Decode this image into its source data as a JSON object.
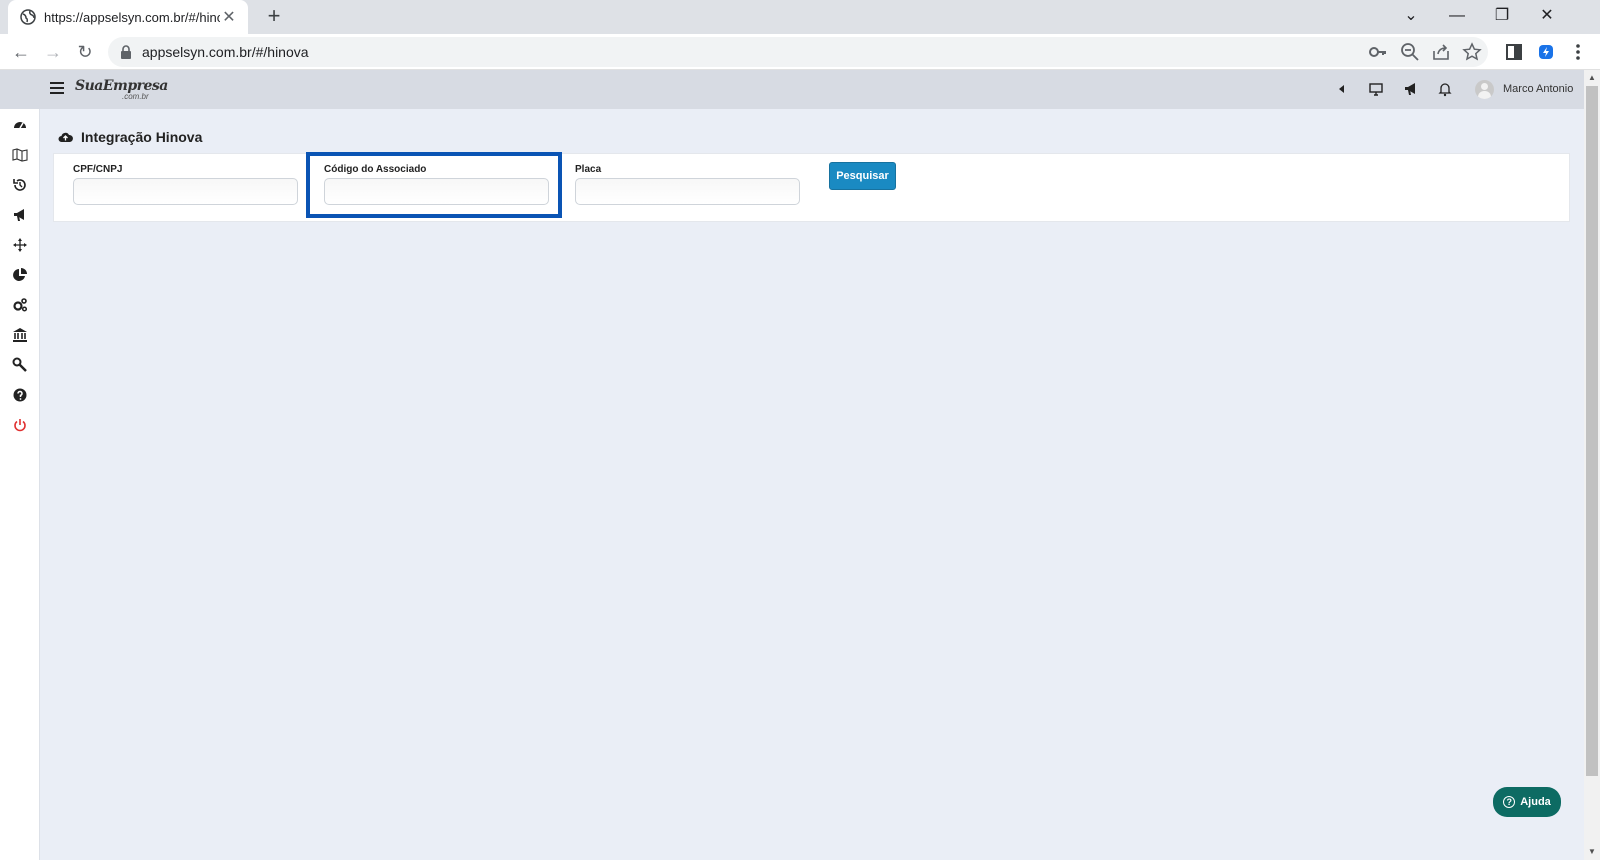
{
  "browser": {
    "tab_title": "https://appselsyn.com.br/#/hinova",
    "new_tab": "+",
    "tab_close": "✕",
    "address": "appselsyn.com.br/#/hinova",
    "window_controls": {
      "dropdown": "⌄",
      "minimize": "—",
      "restore": "❐",
      "close": "✕"
    },
    "nav": {
      "back": "←",
      "forward": "→",
      "reload": "↻"
    },
    "toolbar_icons": [
      "key-icon",
      "zoom-out-icon",
      "share-icon",
      "star-icon",
      "side-panel-icon",
      "extension-icon",
      "menu-icon"
    ]
  },
  "header": {
    "logo": "SuaEmpresa",
    "logo_sub": ".com.br",
    "user_name": "Marco Antonio",
    "icons": [
      "collapse-icon",
      "monitor-icon",
      "megaphone-icon",
      "bell-icon"
    ]
  },
  "sidebar": {
    "icons": [
      "dashboard-icon",
      "map-icon",
      "history-icon",
      "megaphone-icon",
      "move-icon",
      "pie-chart-icon",
      "cogs-icon",
      "bank-icon",
      "wrench-icon",
      "help-icon",
      "power-icon"
    ]
  },
  "page": {
    "title": "Integração Hinova"
  },
  "form": {
    "cpf_label": "CPF/CNPJ",
    "cpf_value": "",
    "codigo_label": "Código do Associado",
    "codigo_value": "",
    "placa_label": "Placa",
    "placa_value": "",
    "search_button": "Pesquisar"
  },
  "help": {
    "label": "Ajuda"
  },
  "colors": {
    "primary_button": "#1a8ac2",
    "help_button": "#0d6b63",
    "highlight_border": "#0a54b4",
    "power_icon": "#e03030"
  }
}
